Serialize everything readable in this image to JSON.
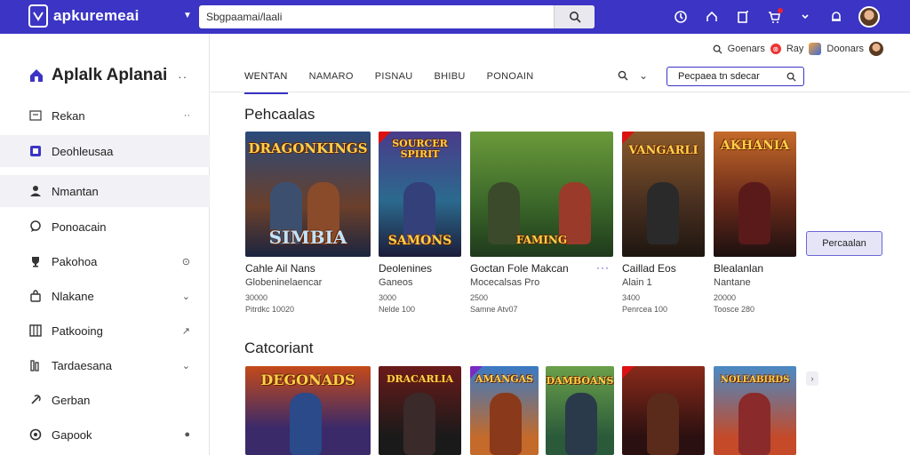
{
  "app": {
    "logo_text": "apkuremeai",
    "search_value": "Sbgpaamai/laali",
    "colors": {
      "accent": "#3b34c4",
      "topbar": "#3b34c4",
      "tab_underline": "#3b34c4"
    }
  },
  "sidebar": {
    "title": "Aplalk Aplanai",
    "title_more": "··",
    "items": [
      {
        "label": "Rekan",
        "icon": "dashboard-icon",
        "trail": "··"
      },
      {
        "label": "Deohleusaa",
        "icon": "square-app-icon",
        "trail": ""
      },
      {
        "label": "Nmantan",
        "icon": "person-icon",
        "trail": ""
      },
      {
        "label": "Ponoacain",
        "icon": "chat-icon",
        "trail": ""
      },
      {
        "label": "Pakohoa",
        "icon": "trophy-icon",
        "trail": "⊙"
      },
      {
        "label": "Nlakane",
        "icon": "bag-icon",
        "trail": "⌄"
      },
      {
        "label": "Patkooing",
        "icon": "grid-icon",
        "trail": "↗"
      },
      {
        "label": "Tardaesana",
        "icon": "library-icon",
        "trail": "⌄"
      },
      {
        "label": "Gerban",
        "icon": "link-icon",
        "trail": ""
      },
      {
        "label": "Gapook",
        "icon": "circle-icon",
        "trail": "●"
      }
    ]
  },
  "subbar": {
    "right_items": {
      "a": "Goenars",
      "b": "Ray",
      "c": "Doonars"
    }
  },
  "tabs": [
    "WENTAN",
    "NAMARO",
    "PISNAU",
    "BHIBU",
    "PONOAIN"
  ],
  "filter_box": "Pecpaea tn sdecar",
  "side_button": "Percaalan",
  "sections": [
    {
      "title": "Pehcaalas",
      "cards": [
        {
          "cover_title": "DRAGONKINGS",
          "cover_sub": "SIMBIA",
          "name": "Cahle Ail Nans",
          "dev": "Globeninelaencar",
          "line1": "30000",
          "line2": "Pitrdkc 10020"
        },
        {
          "cover_title": "SOURCER SPIRIT",
          "cover_sub": "SAMONS",
          "name": "Deolenines",
          "dev": "Ganeos",
          "line1": "3000",
          "line2": "Nelde 100"
        },
        {
          "cover_title": "",
          "cover_sub": "FAMING",
          "name": "Goctan Fole Makcan",
          "dev": "Mocecalsas Pro",
          "line1": "2500",
          "line2": "Samne Atv07"
        },
        {
          "cover_title": "VANGARLI",
          "cover_sub": "",
          "name": "Caillad Eos",
          "dev": "Alain 1",
          "line1": "3400",
          "line2": "Penrcea 100"
        },
        {
          "cover_title": "AKHANIA",
          "cover_sub": "",
          "name": "Blealanlan",
          "dev": "Nantane",
          "line1": "20000",
          "line2": "Toosce 280"
        }
      ]
    },
    {
      "title": "Catcoriant",
      "cards": [
        {
          "cover_title": "DEGONADS"
        },
        {
          "cover_title": "DRACARLIA"
        },
        {
          "cover_title": "AMANGAS"
        },
        {
          "cover_title": "DAMBOANS"
        },
        {
          "cover_title": ""
        },
        {
          "cover_title": "NOLEABIRDS"
        }
      ]
    }
  ]
}
